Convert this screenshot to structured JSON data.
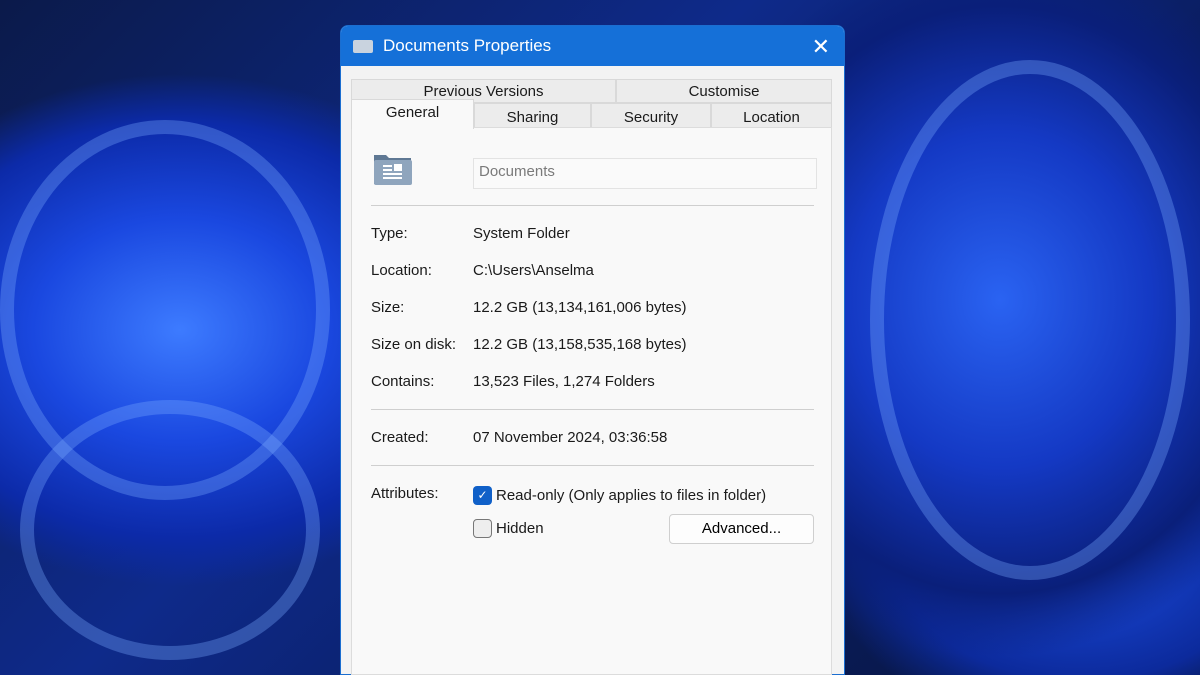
{
  "window": {
    "title": "Documents Properties",
    "close_icon": "close-icon"
  },
  "tabs": {
    "row1": [
      "Previous Versions",
      "Customise"
    ],
    "row2": [
      "General",
      "Sharing",
      "Security",
      "Location"
    ],
    "active": "General"
  },
  "general": {
    "folder_name": "Documents",
    "fields": [
      {
        "label": "Type:",
        "value": "System Folder"
      },
      {
        "label": "Location:",
        "value": "C:\\Users\\Anselma"
      },
      {
        "label": "Size:",
        "value": "12.2 GB (13,134,161,006 bytes)"
      },
      {
        "label": "Size on disk:",
        "value": "12.2 GB (13,158,535,168 bytes)"
      },
      {
        "label": "Contains:",
        "value": "13,523 Files, 1,274 Folders"
      }
    ],
    "created": {
      "label": "Created:",
      "value": "07 November 2024, 03:36:58"
    },
    "attributes": {
      "label": "Attributes:",
      "readonly_label": "Read-only (Only applies to files in folder)",
      "readonly_checked": true,
      "hidden_label": "Hidden",
      "hidden_checked": false,
      "advanced_label": "Advanced..."
    }
  }
}
